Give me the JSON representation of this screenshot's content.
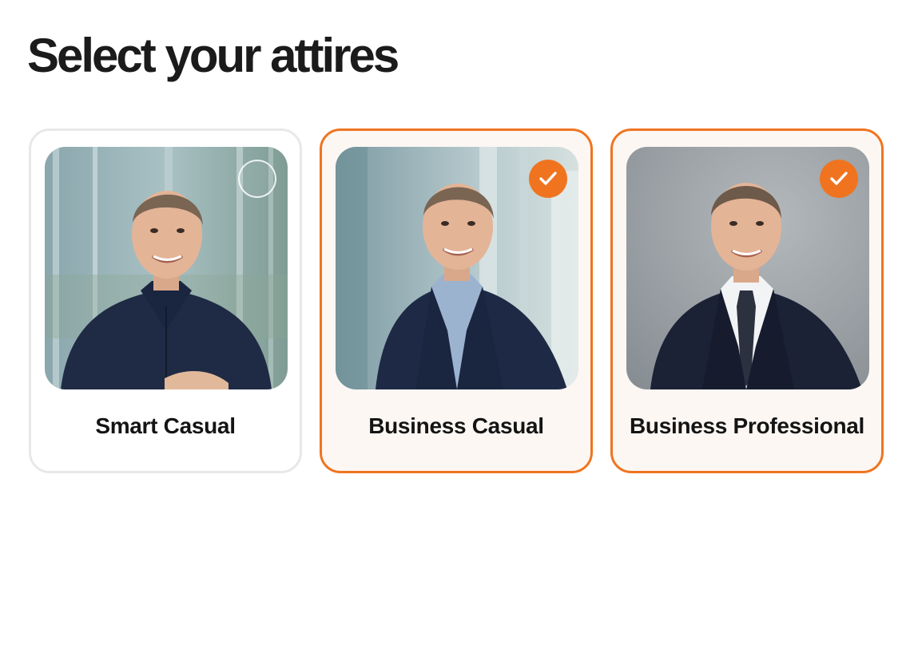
{
  "page": {
    "title": "Select your attires"
  },
  "accent_color": "#f07420",
  "attire_options": [
    {
      "label": "Smart Casual",
      "selected": false,
      "icon": "empty-circle-checkbox"
    },
    {
      "label": "Business Casual",
      "selected": true,
      "icon": "checkmark-icon"
    },
    {
      "label": "Business Professional",
      "selected": true,
      "icon": "checkmark-icon"
    }
  ]
}
